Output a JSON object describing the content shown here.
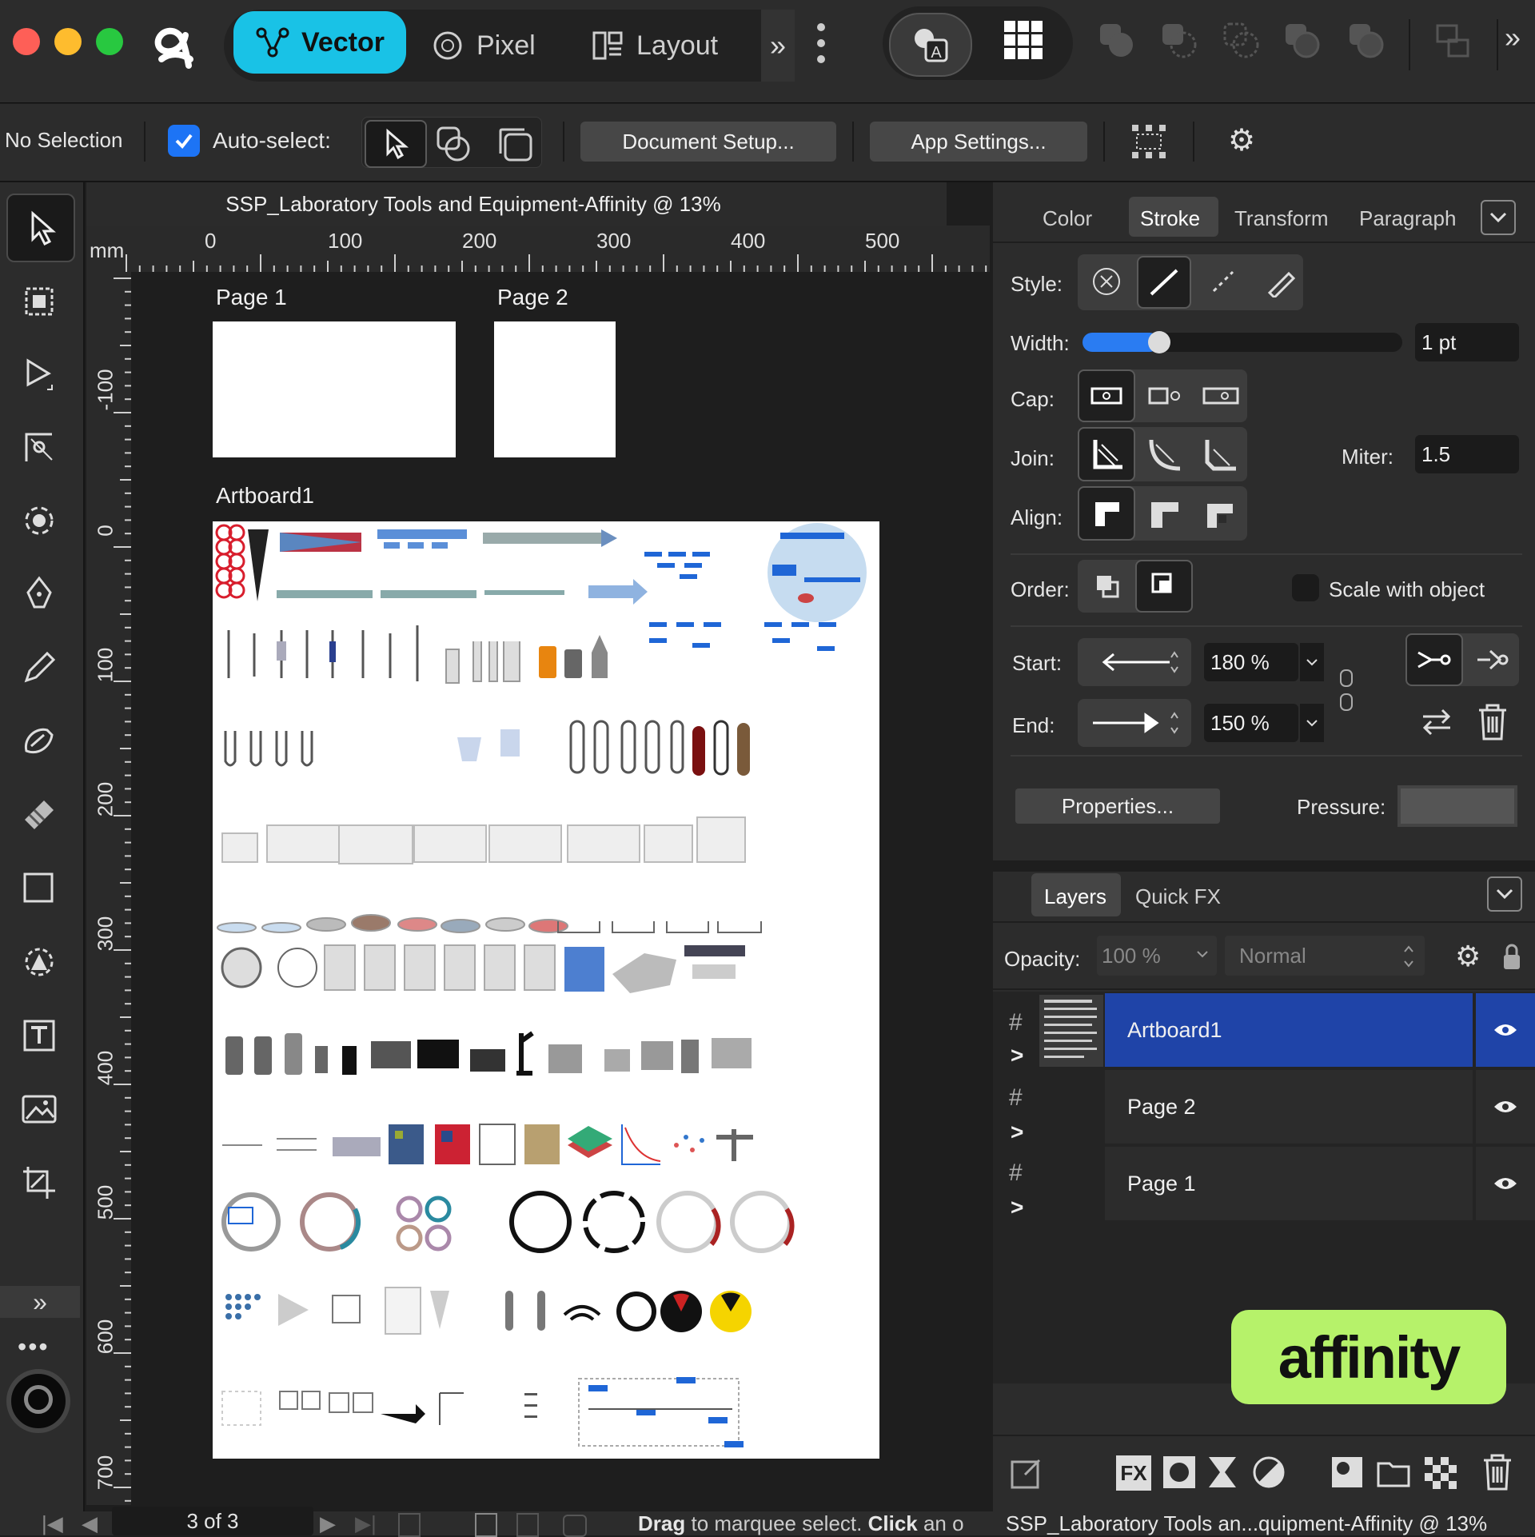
{
  "app": {
    "brand_logo": "affinity-a-logo",
    "badge_text": "affinity",
    "badge_color": "#b6f26a"
  },
  "personas": [
    {
      "label": "Vector",
      "icon": "vector-persona-icon",
      "active": true
    },
    {
      "label": "Pixel",
      "icon": "pixel-persona-icon",
      "active": false
    },
    {
      "label": "Layout",
      "icon": "layout-persona-icon",
      "active": false
    }
  ],
  "colors": {
    "accent": "#19c2e6",
    "selection": "#1f44a8",
    "slider": "#2a7cf2"
  },
  "context": {
    "selection": "No Selection",
    "auto_select_label": "Auto-select:",
    "auto_select_checked": true,
    "document_setup": "Document Setup...",
    "app_settings": "App Settings..."
  },
  "document": {
    "title": "SSP_Laboratory Tools and Equipment-Affinity @ 13%",
    "ruler_unit": "mm",
    "ruler_h": [
      "0",
      "100",
      "200",
      "300",
      "400",
      "500"
    ],
    "ruler_v": [
      "-100",
      "0",
      "100",
      "200",
      "300",
      "400",
      "500",
      "600",
      "700"
    ],
    "page1": "Page 1",
    "page2": "Page 2",
    "artboard": "Artboard1"
  },
  "stroke_panel": {
    "tabs": [
      "Color",
      "Stroke",
      "Transform",
      "Paragraph"
    ],
    "active_tab": "Stroke",
    "style_label": "Style:",
    "width_label": "Width:",
    "width_value": "1 pt",
    "width_fraction": 0.24,
    "cap_label": "Cap:",
    "join_label": "Join:",
    "miter_label": "Miter:",
    "miter_value": "1.5",
    "align_label": "Align:",
    "order_label": "Order:",
    "scale_with_object": "Scale with object",
    "start_label": "Start:",
    "start_value": "180 %",
    "end_label": "End:",
    "end_value": "150 %",
    "properties": "Properties...",
    "pressure_label": "Pressure:"
  },
  "layers_panel": {
    "tabs": [
      "Layers",
      "Quick FX"
    ],
    "opacity_label": "Opacity:",
    "opacity_value": "100 %",
    "blend_mode": "Normal",
    "rows": [
      {
        "name": "Artboard1",
        "selected": true
      },
      {
        "name": "Page 2",
        "selected": false
      },
      {
        "name": "Page 1",
        "selected": false
      }
    ]
  },
  "status": {
    "page_counter": "3 of 3",
    "hint_bold1": "Drag",
    "hint1": " to marquee select. ",
    "hint_bold2": "Click",
    "hint2": " an o",
    "doc_short": "SSP_Laboratory Tools an...quipment-Affinity @ 13%"
  }
}
